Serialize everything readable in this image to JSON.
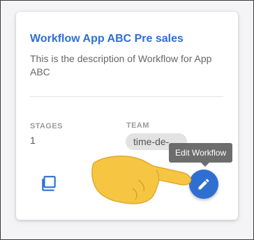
{
  "card": {
    "title": "Workflow App ABC Pre sales",
    "description": "This is the description of Workflow for App ABC",
    "stages_label": "STAGES",
    "stages_value": "1",
    "team_label": "TEAM",
    "team_value": "time-de-"
  },
  "actions": {
    "copy_icon": "copy-icon",
    "edit_icon": "pencil-icon",
    "edit_tooltip": "Edit Workflow"
  },
  "colors": {
    "accent": "#2f6fd1",
    "chip_bg": "#e3e3e3",
    "tooltip_bg": "#616161",
    "hand": "#f6c643"
  },
  "cursor_icon": "pointing-hand-icon"
}
